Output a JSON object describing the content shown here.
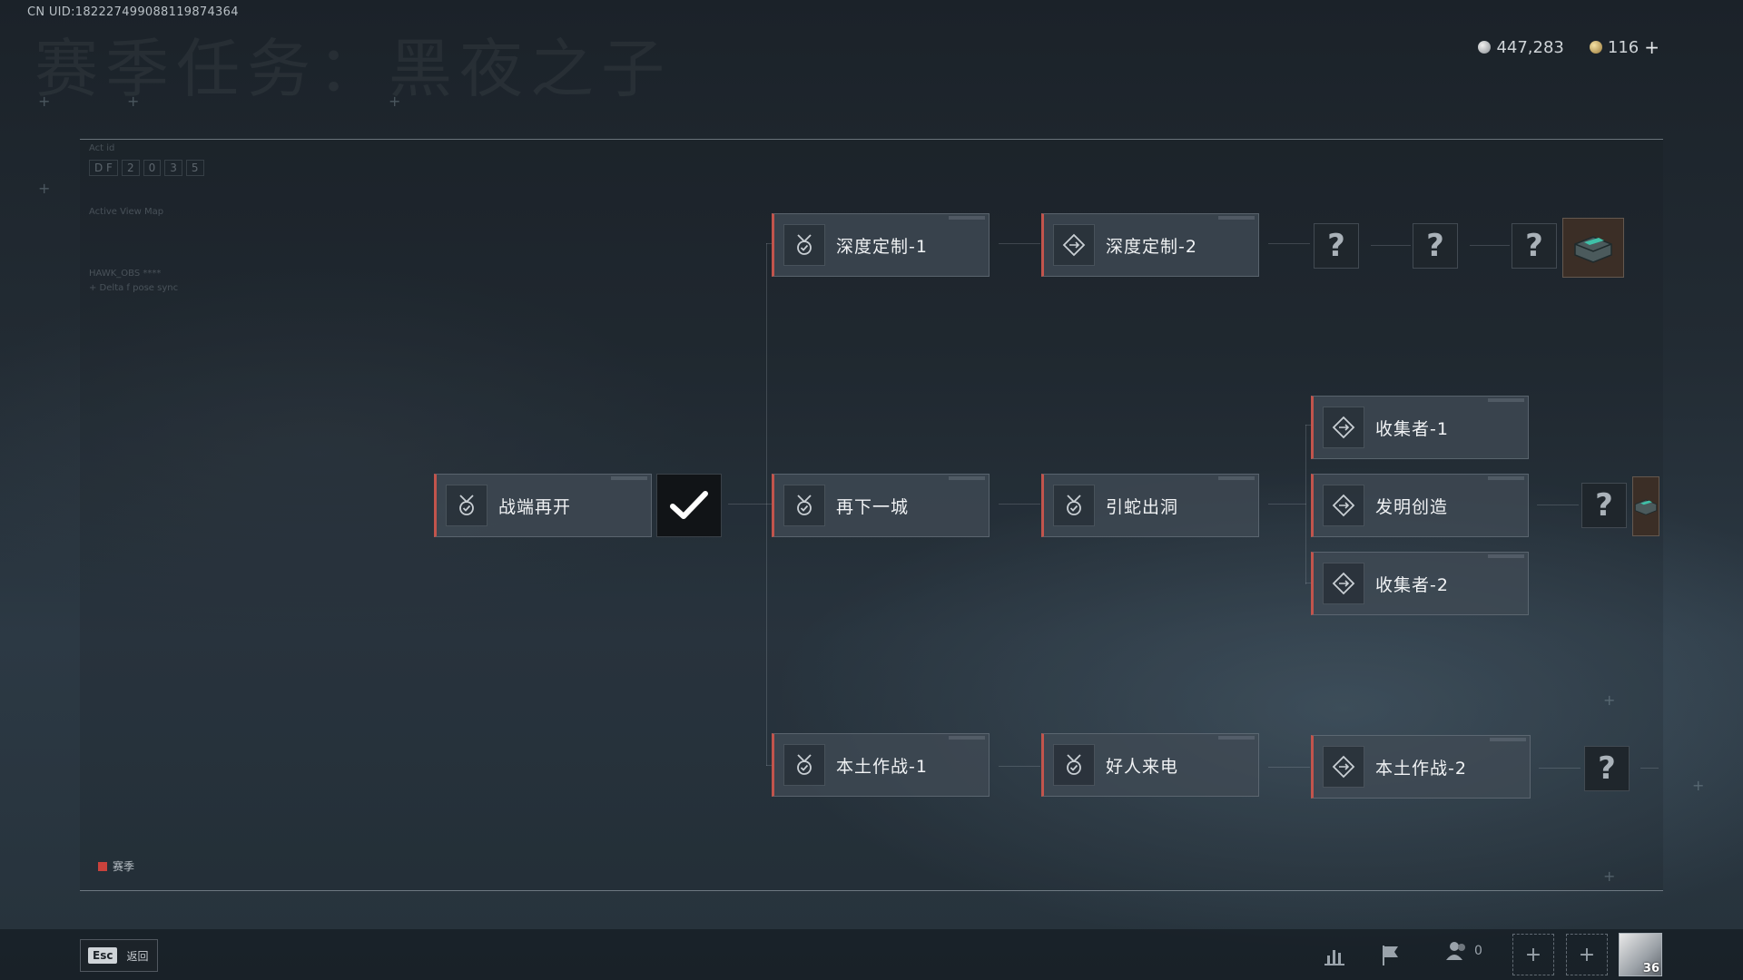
{
  "header": {
    "uid": "CN UID:18222749908811987436​4",
    "title": "赛季任务：黑夜之子",
    "currency": {
      "silver": "447,283",
      "gold": "116",
      "plus": "+"
    }
  },
  "hud": {
    "line1": "Act id",
    "boxes": [
      "D F",
      "2",
      "0",
      "3",
      "5"
    ],
    "line2": "Active View Map",
    "line3": "HAWK_OBS ****",
    "line4": "+ Delta f  pose sync"
  },
  "nodes": {
    "zhanduan": "战端再开",
    "zaixia": "再下一城",
    "yinshe": "引蛇出洞",
    "shendu1": "深度定制-1",
    "shendu2": "深度定制-2",
    "shouji1": "收集者-1",
    "faming": "发明创造",
    "shouji2": "收集者-2",
    "bentu1": "本土作战-1",
    "haoren": "好人来电",
    "bentu2": "本土作战-2"
  },
  "unknown_mark": "?",
  "legend": {
    "label": "赛季",
    "color": "#c9423c"
  },
  "bottom": {
    "esc_key": "Esc",
    "esc_label": "返回",
    "friends_count": "0",
    "slot_plus": "+",
    "level": "36"
  },
  "colors": {
    "accent": "#c2544c",
    "node_bg": "#404a54"
  }
}
